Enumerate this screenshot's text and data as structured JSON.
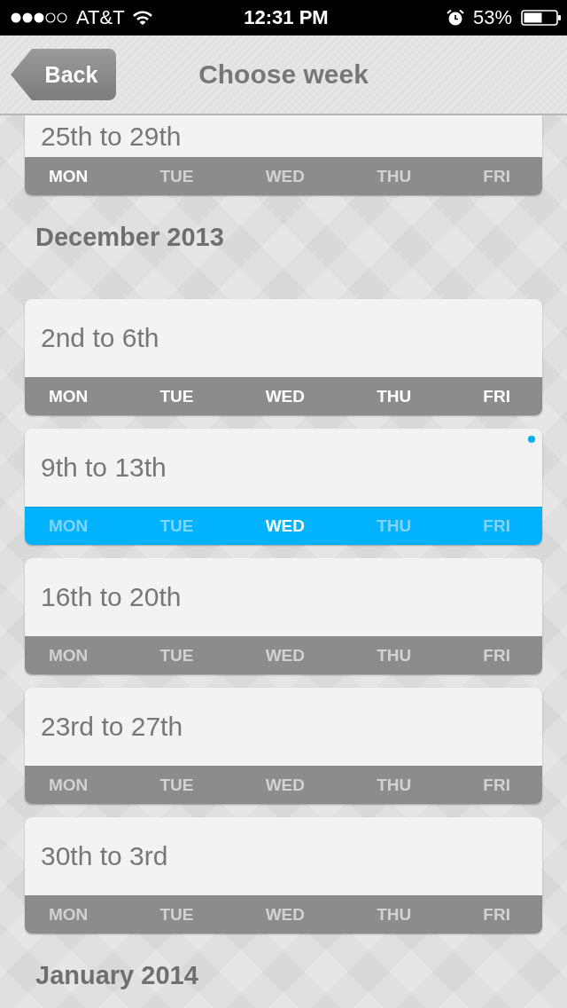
{
  "status_bar": {
    "carrier": "AT&T",
    "time": "12:31 PM",
    "battery": "53%"
  },
  "nav": {
    "back": "Back",
    "title": "Choose week"
  },
  "items": [
    {
      "kind": "week",
      "label": "25th to 29th",
      "selected": false,
      "days": [
        {
          "label": "MON",
          "on": true
        },
        {
          "label": "TUE",
          "on": false
        },
        {
          "label": "WED",
          "on": false
        },
        {
          "label": "THU",
          "on": false
        },
        {
          "label": "FRI",
          "on": false
        }
      ]
    },
    {
      "kind": "heading",
      "label": "December 2013"
    },
    {
      "kind": "week",
      "label": "2nd to 6th",
      "selected": false,
      "days": [
        {
          "label": "MON",
          "on": true
        },
        {
          "label": "TUE",
          "on": true
        },
        {
          "label": "WED",
          "on": true
        },
        {
          "label": "THU",
          "on": true
        },
        {
          "label": "FRI",
          "on": true
        }
      ]
    },
    {
      "kind": "week",
      "label": "9th to 13th",
      "selected": true,
      "days": [
        {
          "label": "MON",
          "on": false
        },
        {
          "label": "TUE",
          "on": false
        },
        {
          "label": "WED",
          "on": true
        },
        {
          "label": "THU",
          "on": false
        },
        {
          "label": "FRI",
          "on": false
        }
      ]
    },
    {
      "kind": "week",
      "label": "16th to 20th",
      "selected": false,
      "days": [
        {
          "label": "MON",
          "on": false
        },
        {
          "label": "TUE",
          "on": false
        },
        {
          "label": "WED",
          "on": false
        },
        {
          "label": "THU",
          "on": false
        },
        {
          "label": "FRI",
          "on": false
        }
      ]
    },
    {
      "kind": "week",
      "label": "23rd to 27th",
      "selected": false,
      "days": [
        {
          "label": "MON",
          "on": false
        },
        {
          "label": "TUE",
          "on": false
        },
        {
          "label": "WED",
          "on": false
        },
        {
          "label": "THU",
          "on": false
        },
        {
          "label": "FRI",
          "on": false
        }
      ]
    },
    {
      "kind": "week",
      "label": "30th to 3rd",
      "selected": false,
      "days": [
        {
          "label": "MON",
          "on": false
        },
        {
          "label": "TUE",
          "on": false
        },
        {
          "label": "WED",
          "on": false
        },
        {
          "label": "THU",
          "on": false
        },
        {
          "label": "FRI",
          "on": false
        }
      ]
    },
    {
      "kind": "heading",
      "label": "January 2014"
    }
  ]
}
